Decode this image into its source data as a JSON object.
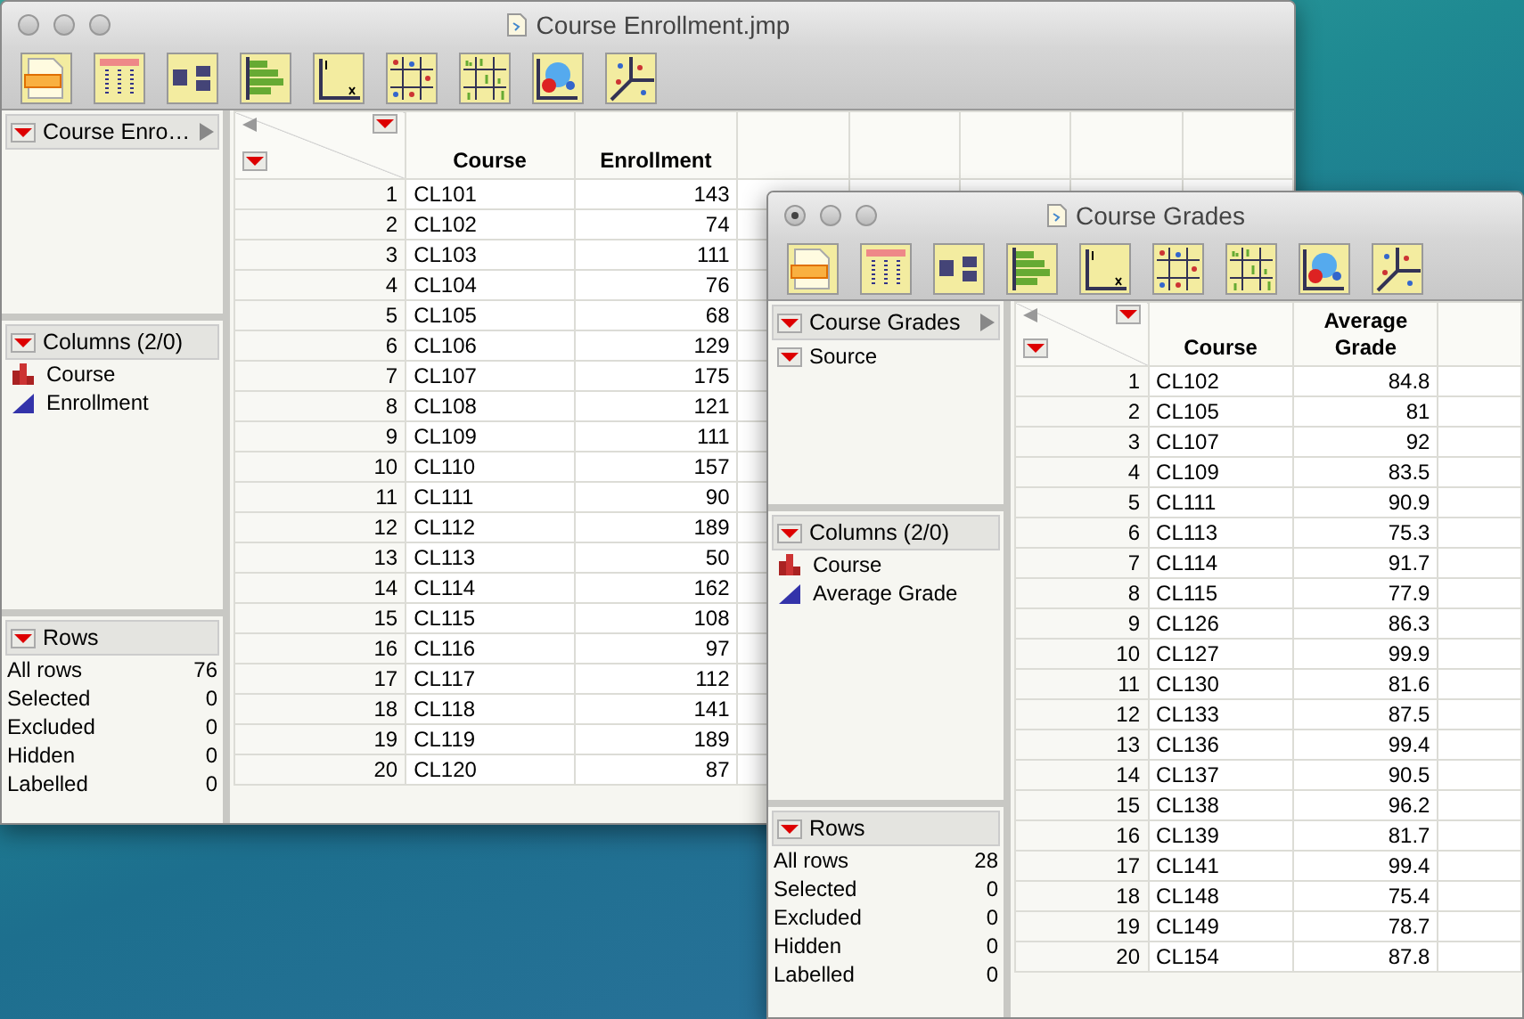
{
  "windows": [
    {
      "title": "Course Enrollment.jmp",
      "unsaved": false,
      "table_panel": {
        "title": "Course Enro…"
      },
      "columns_panel": {
        "title": "Columns (2/0)",
        "items": [
          {
            "name": "Course",
            "kind": "nominal"
          },
          {
            "name": "Enrollment",
            "kind": "continuous"
          }
        ]
      },
      "rows_panel": {
        "title": "Rows",
        "items": [
          {
            "label": "All rows",
            "value": "76"
          },
          {
            "label": "Selected",
            "value": "0"
          },
          {
            "label": "Excluded",
            "value": "0"
          },
          {
            "label": "Hidden",
            "value": "0"
          },
          {
            "label": "Labelled",
            "value": "0"
          }
        ]
      },
      "table": {
        "columns": [
          "",
          "Course",
          "Enrollment"
        ],
        "rows": [
          [
            "1",
            "CL101",
            "143"
          ],
          [
            "2",
            "CL102",
            "74"
          ],
          [
            "3",
            "CL103",
            "111"
          ],
          [
            "4",
            "CL104",
            "76"
          ],
          [
            "5",
            "CL105",
            "68"
          ],
          [
            "6",
            "CL106",
            "129"
          ],
          [
            "7",
            "CL107",
            "175"
          ],
          [
            "8",
            "CL108",
            "121"
          ],
          [
            "9",
            "CL109",
            "111"
          ],
          [
            "10",
            "CL110",
            "157"
          ],
          [
            "11",
            "CL111",
            "90"
          ],
          [
            "12",
            "CL112",
            "189"
          ],
          [
            "13",
            "CL113",
            "50"
          ],
          [
            "14",
            "CL114",
            "162"
          ],
          [
            "15",
            "CL115",
            "108"
          ],
          [
            "16",
            "CL116",
            "97"
          ],
          [
            "17",
            "CL117",
            "112"
          ],
          [
            "18",
            "CL118",
            "141"
          ],
          [
            "19",
            "CL119",
            "189"
          ],
          [
            "20",
            "CL120",
            "87"
          ]
        ]
      }
    },
    {
      "title": "Course Grades",
      "unsaved": true,
      "table_panel": {
        "title": "Course Grades",
        "scripts": [
          "Source"
        ]
      },
      "columns_panel": {
        "title": "Columns (2/0)",
        "items": [
          {
            "name": "Course",
            "kind": "nominal"
          },
          {
            "name": "Average Grade",
            "kind": "continuous"
          }
        ]
      },
      "rows_panel": {
        "title": "Rows",
        "items": [
          {
            "label": "All rows",
            "value": "28"
          },
          {
            "label": "Selected",
            "value": "0"
          },
          {
            "label": "Excluded",
            "value": "0"
          },
          {
            "label": "Hidden",
            "value": "0"
          },
          {
            "label": "Labelled",
            "value": "0"
          }
        ]
      },
      "table": {
        "columns": [
          "",
          "Course",
          "Average Grade"
        ],
        "rows": [
          [
            "1",
            "CL102",
            "84.8"
          ],
          [
            "2",
            "CL105",
            "81"
          ],
          [
            "3",
            "CL107",
            "92"
          ],
          [
            "4",
            "CL109",
            "83.5"
          ],
          [
            "5",
            "CL111",
            "90.9"
          ],
          [
            "6",
            "CL113",
            "75.3"
          ],
          [
            "7",
            "CL114",
            "91.7"
          ],
          [
            "8",
            "CL115",
            "77.9"
          ],
          [
            "9",
            "CL126",
            "86.3"
          ],
          [
            "10",
            "CL127",
            "99.9"
          ],
          [
            "11",
            "CL130",
            "81.6"
          ],
          [
            "12",
            "CL133",
            "87.5"
          ],
          [
            "13",
            "CL136",
            "99.4"
          ],
          [
            "14",
            "CL137",
            "90.5"
          ],
          [
            "15",
            "CL138",
            "96.2"
          ],
          [
            "16",
            "CL139",
            "81.7"
          ],
          [
            "17",
            "CL141",
            "99.4"
          ],
          [
            "18",
            "CL148",
            "75.4"
          ],
          [
            "19",
            "CL149",
            "78.7"
          ],
          [
            "20",
            "CL154",
            "87.8"
          ]
        ]
      }
    }
  ]
}
